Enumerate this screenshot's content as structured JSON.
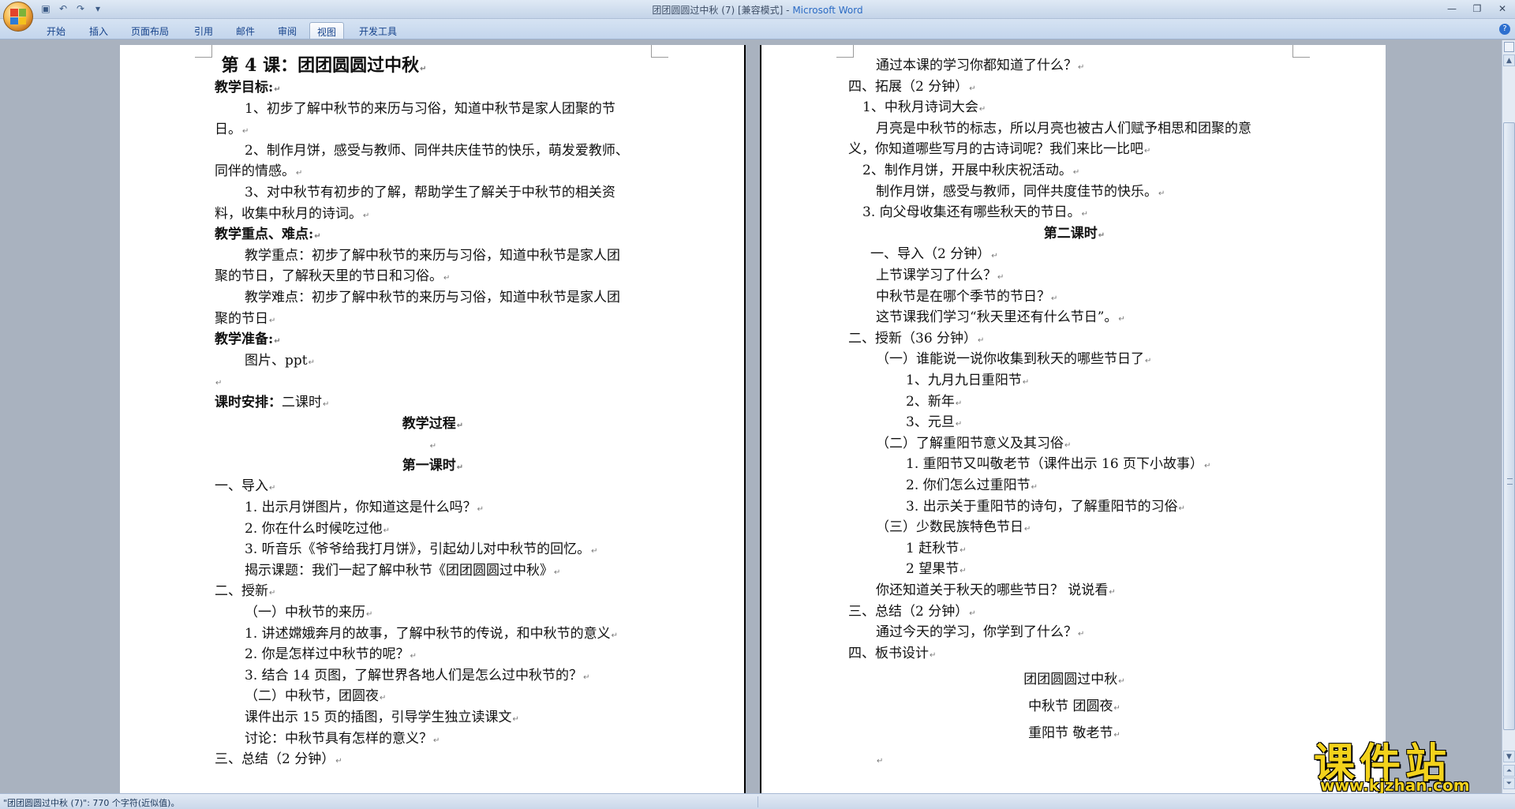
{
  "window": {
    "title": "团团圆圆过中秋 (7) [兼容模式] - ",
    "app_name": "Microsoft Word"
  },
  "ribbon": {
    "tabs": [
      {
        "label": "开始"
      },
      {
        "label": "插入"
      },
      {
        "label": "页面布局"
      },
      {
        "label": "引用"
      },
      {
        "label": "邮件"
      },
      {
        "label": "审阅"
      },
      {
        "label": "视图",
        "active": true
      },
      {
        "label": "开发工具"
      }
    ]
  },
  "document": {
    "page1": [
      {
        "text": "第 4 课：团团圆圆过中秋",
        "style": "title",
        "mark": "↵"
      },
      {
        "text": "教学目标:",
        "style": "b",
        "mark": "↵"
      },
      {
        "text": "1、初步了解中秋节的来历与习俗，知道中秋节是家人团聚的节"
      },
      {
        "text": "日。",
        "mark": "↵"
      },
      {
        "text": "2、制作月饼，感受与教师、同伴共庆佳节的快乐，萌发爱教师、"
      },
      {
        "text": "同伴的情感。",
        "mark": "↵"
      },
      {
        "text": "3、对中秋节有初步的了解，帮助学生了解关于中秋节的相关资"
      },
      {
        "text": "料，收集中秋月的诗词。",
        "mark": "↵"
      },
      {
        "text": "教学重点、难点:",
        "style": "b",
        "mark": "↵"
      },
      {
        "text": "教学重点：初步了解中秋节的来历与习俗，知道中秋节是家人团"
      },
      {
        "text": "聚的节日，了解秋天里的节日和习俗。",
        "mark": "↵"
      },
      {
        "text": "教学难点：初步了解中秋节的来历与习俗，知道中秋节是家人团"
      },
      {
        "text": "聚的节日",
        "mark": "↵"
      },
      {
        "text": "教学准备:",
        "style": "b",
        "mark": "↵"
      },
      {
        "text": "图片、ppt",
        "mark": "↵"
      },
      {
        "text": "",
        "mark": "↵"
      },
      {
        "text": "课时安排：二课时",
        "style": "b-lead",
        "mark": "↵"
      },
      {
        "text": "教学过程",
        "style": "b",
        "mark": "↵"
      },
      {
        "text": "",
        "mark": "↵"
      },
      {
        "text": "第一课时",
        "style": "b",
        "mark": "↵"
      },
      {
        "text": "一、导入",
        "mark": "↵"
      },
      {
        "text": "1. 出示月饼图片，你知道这是什么吗？",
        "mark": "↵"
      },
      {
        "text": "2. 你在什么时候吃过他",
        "mark": "↵"
      },
      {
        "text": "3. 听音乐《爷爷给我打月饼》，引起幼儿对中秋节的回忆。",
        "mark": "↵"
      },
      {
        "text": "揭示课题：我们一起了解中秋节《团团圆圆过中秋》",
        "mark": "↵"
      },
      {
        "text": "二、授新",
        "mark": "↵"
      },
      {
        "text": "（一）中秋节的来历",
        "mark": "↵"
      },
      {
        "text": "1. 讲述嫦娥奔月的故事，了解中秋节的传说，和中秋节的意义",
        "mark": "↵"
      },
      {
        "text": "2. 你是怎样过中秋节的呢？",
        "mark": "↵"
      },
      {
        "text": "3. 结合 14 页图，了解世界各地人们是怎么过中秋节的？",
        "mark": "↵"
      },
      {
        "text": "（二）中秋节，团圆夜",
        "mark": "↵"
      },
      {
        "text": "课件出示 15 页的插图，引导学生独立读课文",
        "mark": "↵"
      },
      {
        "text": "讨论：中秋节具有怎样的意义？",
        "mark": "↵"
      },
      {
        "text": "三、总结（2 分钟）",
        "mark": "↵"
      }
    ],
    "page2": [
      {
        "text": "通过本课的学习你都知道了什么？",
        "mark": "↵"
      },
      {
        "text": "四、拓展（2 分钟）",
        "mark": "↵"
      },
      {
        "text": "1、中秋月诗词大会",
        "mark": "↵"
      },
      {
        "text": "月亮是中秋节的标志，所以月亮也被古人们赋予相思和团聚的意"
      },
      {
        "text": "义，你知道哪些写月的古诗词呢？我们来比一比吧",
        "mark": "↵"
      },
      {
        "text": "2、制作月饼，开展中秋庆祝活动。",
        "mark": "↵"
      },
      {
        "text": "制作月饼，感受与教师，同伴共度佳节的快乐。",
        "mark": "↵"
      },
      {
        "text": "3. 向父母收集还有哪些秋天的节日。",
        "mark": "↵"
      },
      {
        "text": "第二课时",
        "style": "b",
        "mark": "↵"
      },
      {
        "text": "一、导入（2 分钟）",
        "mark": "↵"
      },
      {
        "text": "上节课学习了什么？",
        "mark": "↵"
      },
      {
        "text": "中秋节是在哪个季节的节日？",
        "mark": "↵"
      },
      {
        "text": "这节课我们学习“秋天里还有什么节日”。",
        "mark": "↵"
      },
      {
        "text": "二、授新（36 分钟）",
        "mark": "↵"
      },
      {
        "text": "（一）谁能说一说你收集到秋天的哪些节日了",
        "mark": "↵"
      },
      {
        "text": "1、九月九日重阳节",
        "mark": "↵"
      },
      {
        "text": "2、新年",
        "mark": "↵"
      },
      {
        "text": "3、元旦",
        "mark": "↵"
      },
      {
        "text": "（二）了解重阳节意义及其习俗",
        "mark": "↵"
      },
      {
        "text": "1. 重阳节又叫敬老节（课件出示 16 页下小故事）",
        "mark": "↵"
      },
      {
        "text": "2. 你们怎么过重阳节",
        "mark": "↵"
      },
      {
        "text": "3. 出示关于重阳节的诗句，了解重阳节的习俗",
        "mark": "↵"
      },
      {
        "text": "（三）少数民族特色节日",
        "mark": "↵"
      },
      {
        "text": "1 赶秋节",
        "mark": "↵"
      },
      {
        "text": "2 望果节",
        "mark": "↵"
      },
      {
        "text": "你还知道关于秋天的哪些节日？ 说说看",
        "mark": "↵"
      },
      {
        "text": "三、总结（2 分钟）",
        "mark": "↵"
      },
      {
        "text": "通过今天的学习，你学到了什么？",
        "mark": "↵"
      },
      {
        "text": "四、板书设计",
        "mark": "↵"
      },
      {
        "text": "团团圆圆过中秋",
        "mark": "↵"
      },
      {
        "text": "中秋节 团圆夜",
        "mark": "↵"
      },
      {
        "text": "重阳节 敬老节",
        "mark": "↵"
      },
      {
        "text": "",
        "mark": "↵"
      }
    ]
  },
  "status": {
    "text": "\"团团圆圆过中秋 (7)\": 770 个字符(近似值)。"
  },
  "watermark": {
    "title": "课件站",
    "url": "www.kjzhan.com"
  },
  "colors": {
    "accent": "#2b6bc4",
    "workspace": "#a9b2bf",
    "watermark": "#f3d21b"
  }
}
